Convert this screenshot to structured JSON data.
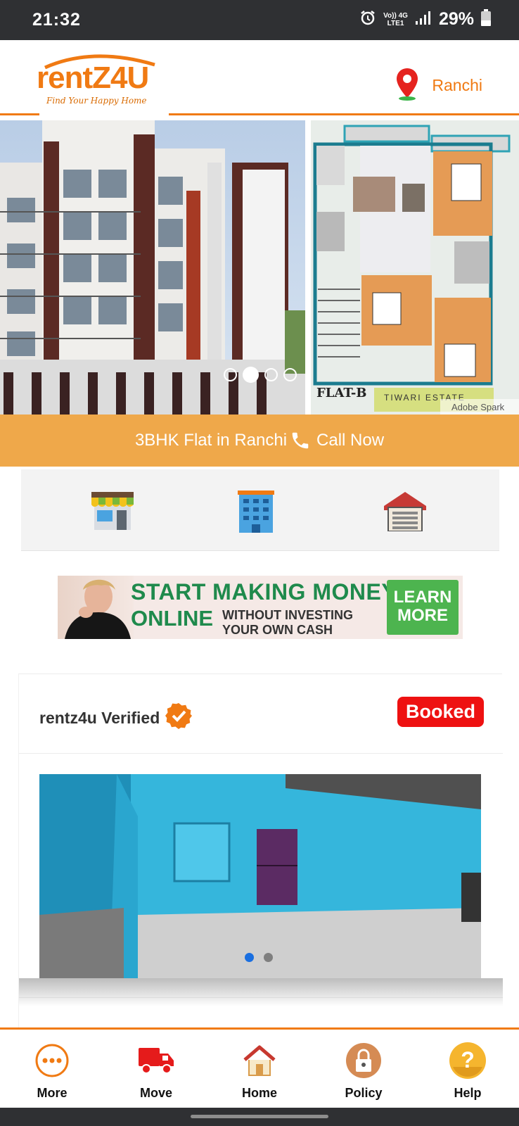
{
  "status_bar": {
    "time": "21:32",
    "network_top": "Vo)) 4G",
    "network_bottom": "LTE1",
    "battery": "29%"
  },
  "header": {
    "logo_text": "rentZ4U",
    "logo_tagline": "Find Your Happy Home",
    "location": "Ranchi"
  },
  "hero": {
    "plan_label": "FLAT-B",
    "watermark": "Adobe Spark",
    "estate_text": "TIWARI ESTATE",
    "active_dot": 1
  },
  "callbar": {
    "title": "3BHK Flat in Ranchi",
    "action": "Call Now"
  },
  "categories": [
    {
      "icon": "shop-icon"
    },
    {
      "icon": "building-icon"
    },
    {
      "icon": "garage-icon"
    }
  ],
  "ad": {
    "line1": "START MAKING MONEY",
    "line2": "ONLINE",
    "line3a": "WITHOUT INVESTING",
    "line3b": "YOUR OWN CASH",
    "cta": "LEARN MORE"
  },
  "listing": {
    "verified_label": "rentz4u Verified",
    "status_badge": "Booked",
    "photo_active_dot": 0
  },
  "bottom_nav": [
    {
      "label": "More",
      "icon": "more-icon"
    },
    {
      "label": "Move",
      "icon": "truck-icon"
    },
    {
      "label": "Home",
      "icon": "home-icon"
    },
    {
      "label": "Policy",
      "icon": "lock-icon"
    },
    {
      "label": "Help",
      "icon": "help-icon"
    }
  ],
  "colors": {
    "brand": "#f07a13",
    "callbar": "#efa84a",
    "booked": "#ee1111",
    "verified": "#f07a13"
  }
}
